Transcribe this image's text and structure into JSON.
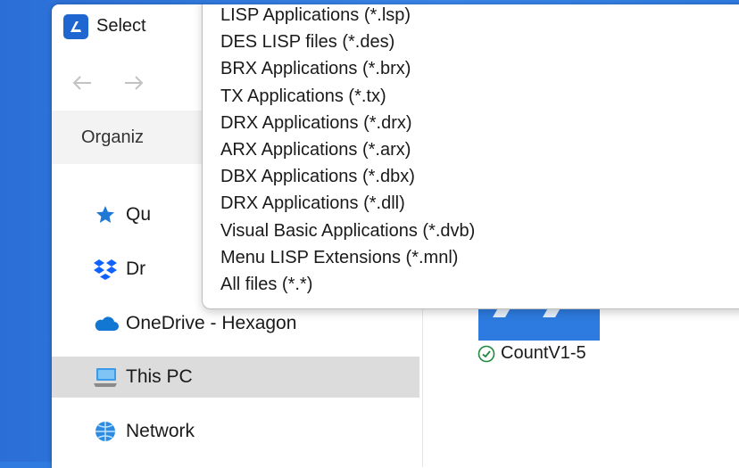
{
  "window": {
    "title": "Select"
  },
  "toolbar": {
    "organize_label": "Organiz"
  },
  "nav_pane": {
    "items": [
      {
        "label": "Qu",
        "icon": "star-icon"
      },
      {
        "label": "Dr",
        "icon": "dropbox-icon"
      },
      {
        "label": "OneDrive - Hexagon",
        "icon": "onedrive-cloud-icon"
      },
      {
        "label": "This PC",
        "icon": "computer-icon",
        "selected": true
      },
      {
        "label": "Network",
        "icon": "network-icon"
      }
    ]
  },
  "content": {
    "file_name": "CountV1-5",
    "sync_status": "synced"
  },
  "file_type_dropdown": {
    "options": [
      "LISP Applications (*.lsp)",
      "DES LISP files (*.des)",
      "BRX Applications (*.brx)",
      "TX Applications (*.tx)",
      "DRX Applications (*.drx)",
      "ARX Applications (*.arx)",
      "DBX Applications (*.dbx)",
      "DRX Applications (*.dll)",
      "Visual Basic Applications (*.dvb)",
      "Menu LISP Extensions (*.mnl)",
      "All files (*.*)"
    ]
  },
  "colors": {
    "desktop_blue": "#2f7be0",
    "selected_row": "#dcdcdc",
    "command_bar": "#f3f3f3",
    "sync_green": "#1e8a3e"
  }
}
